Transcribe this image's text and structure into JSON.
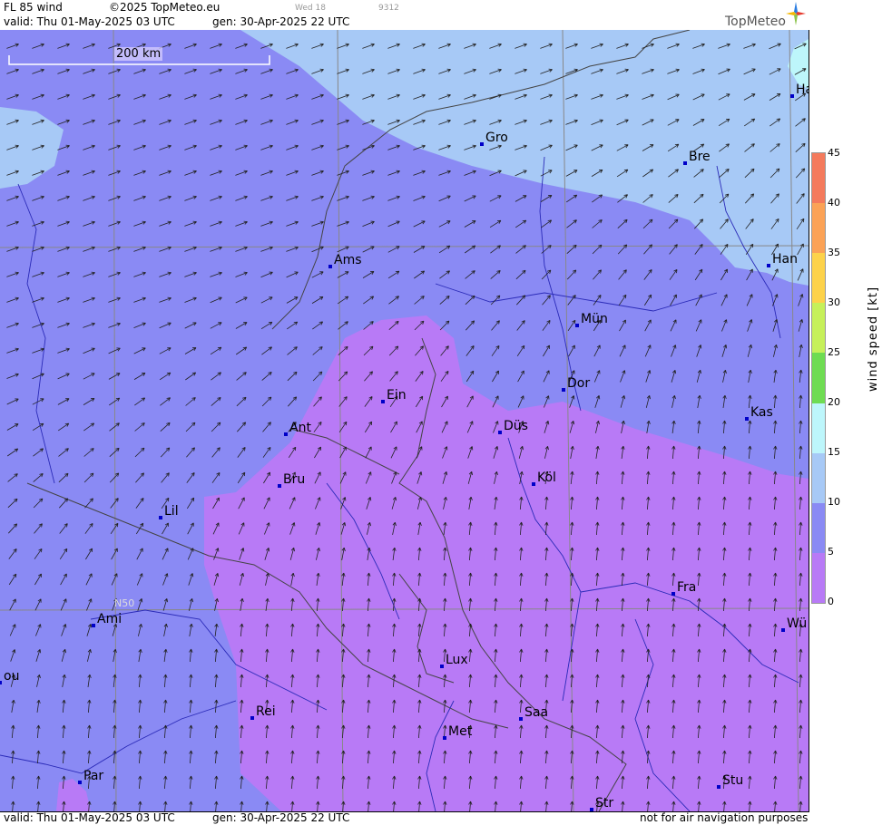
{
  "header": {
    "product": "FL 85 wind",
    "copyright": "©2025 TopMeteo.eu",
    "valid": "valid:  Thu   01-May-2025  03 UTC",
    "generated": "gen: 30-Apr-2025 22 UTC",
    "day_tag": "Wed 18",
    "code": "9312",
    "brand": "TopMeteo"
  },
  "footer": {
    "valid": "valid:  Thu   01-May-2025  03 UTC",
    "generated": "gen: 30-Apr-2025 22 UTC",
    "disclaimer": "not for air navigation purposes"
  },
  "map": {
    "scale_label": "200 km",
    "lat_label": "N50",
    "cities": [
      {
        "name": "Gro"
      },
      {
        "name": "Bre"
      },
      {
        "name": "Ha"
      },
      {
        "name": "Han"
      },
      {
        "name": "Ams"
      },
      {
        "name": "Mün"
      },
      {
        "name": "Ein"
      },
      {
        "name": "Dor"
      },
      {
        "name": "Kas"
      },
      {
        "name": "Ant"
      },
      {
        "name": "Düs"
      },
      {
        "name": "Bru"
      },
      {
        "name": "Köl"
      },
      {
        "name": "Lil"
      },
      {
        "name": "Fra"
      },
      {
        "name": "Ami"
      },
      {
        "name": "Wü"
      },
      {
        "name": "ou"
      },
      {
        "name": "Lux"
      },
      {
        "name": "Rei"
      },
      {
        "name": "Saa"
      },
      {
        "name": "Met"
      },
      {
        "name": "Stu"
      },
      {
        "name": "Par"
      },
      {
        "name": "Str"
      }
    ]
  },
  "legend": {
    "ylabel": "wind speed [kt]",
    "ticks": [
      "45",
      "40",
      "35",
      "30",
      "25",
      "20",
      "15",
      "10",
      "5",
      "0"
    ],
    "colors": [
      "#f47a5c",
      "#fba256",
      "#fdd24a",
      "#f6f65a",
      "#c6f05a",
      "#6edc52",
      "#a7f0d8",
      "#bdf6fb",
      "#a7c9f6",
      "#8a8af4",
      "#b87af6"
    ]
  }
}
